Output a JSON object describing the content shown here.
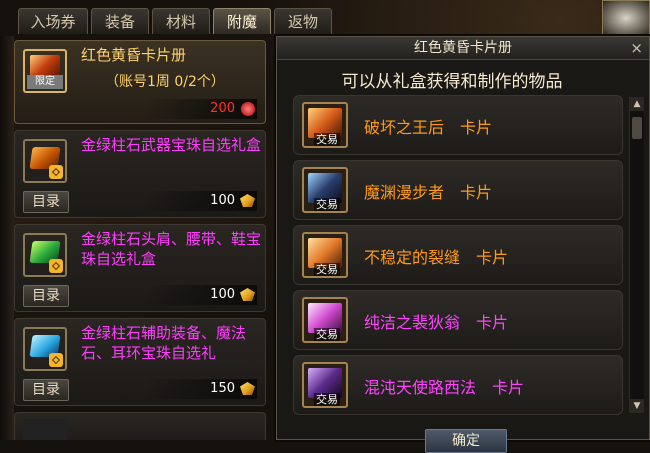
{
  "tabs": [
    {
      "label": "入场券",
      "active": false
    },
    {
      "label": "装备",
      "active": false
    },
    {
      "label": "材料",
      "active": false
    },
    {
      "label": "附魔",
      "active": true
    },
    {
      "label": "返物",
      "active": false
    }
  ],
  "shop": {
    "featured": {
      "name": "红色黄昏卡片册",
      "limit": "（账号1周 0/2个）",
      "tag": "限定",
      "price": "200"
    },
    "items": [
      {
        "name": "金绿柱石武器宝珠自选礼盒",
        "catalog_label": "目录",
        "price": "100"
      },
      {
        "name": "金绿柱石头肩、腰带、鞋宝珠自选礼盒",
        "catalog_label": "目录",
        "price": "100"
      },
      {
        "name": "金绿柱石辅助装备、魔法石、耳环宝珠自选礼",
        "catalog_label": "目录",
        "price": "150"
      }
    ]
  },
  "popup": {
    "title": "红色黄昏卡片册",
    "close": "×",
    "subtitle": "可以从礼盒获得和制作的物品",
    "trade_tag": "交易",
    "cards": [
      {
        "name": "破坏之王后　卡片",
        "color": "#ff9a1a"
      },
      {
        "name": "魔渊漫步者　卡片",
        "color": "#ff9a1a"
      },
      {
        "name": "不稳定的裂缝　卡片",
        "color": "#ff9a1a"
      },
      {
        "name": "纯洁之裴狄翁　卡片",
        "color": "#ff44ff"
      },
      {
        "name": "混沌天使路西法　卡片",
        "color": "#ff44ff"
      }
    ],
    "confirm": "确定"
  }
}
